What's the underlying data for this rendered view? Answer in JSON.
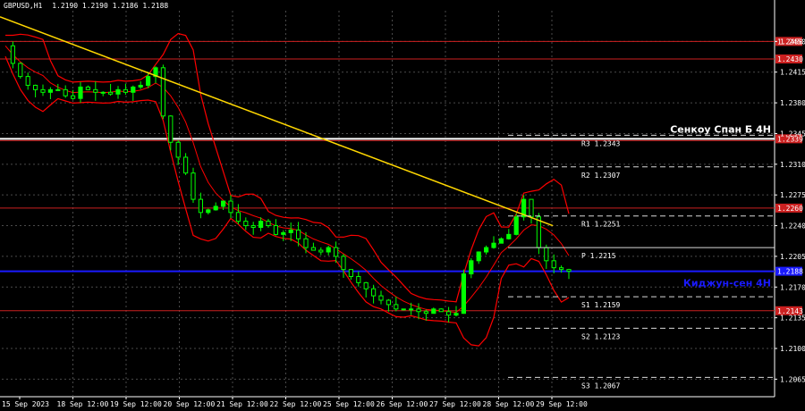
{
  "header": {
    "symbol": "GBPUSD,H1",
    "ohlc": "1.2190 1.2190 1.2186 1.2188"
  },
  "colors": {
    "background": "#000000",
    "grid": "#4a4a4a",
    "bull_candle": "#00ff00",
    "bear_candle": "#00ff00",
    "bollinger": "#ff0000",
    "trendline": "#ffd700",
    "kijun": "#1a1aff",
    "level_line": "#cc2020",
    "pivot": "#d9d9d9",
    "axis_text": "#ffffff"
  },
  "chart_data": {
    "type": "candlestick",
    "xlabel": "",
    "ylabel": "",
    "ylim": [
      1.2045,
      1.2485
    ],
    "x_ticks": [
      "15 Sep 2023",
      "18 Sep 12:00",
      "19 Sep 12:00",
      "20 Sep 12:00",
      "21 Sep 12:00",
      "22 Sep 12:00",
      "25 Sep 12:00",
      "26 Sep 12:00",
      "27 Sep 12:00",
      "28 Sep 12:00",
      "29 Sep 12:00"
    ],
    "y_ticks": [
      "1.2450",
      "1.2415",
      "1.2380",
      "1.2345",
      "1.2310",
      "1.2275",
      "1.2240",
      "1.2205",
      "1.2170",
      "1.2135",
      "1.2100",
      "1.2065"
    ],
    "close_path": [
      1.2445,
      1.2425,
      1.241,
      1.24,
      1.2395,
      1.2392,
      1.2395,
      1.2395,
      1.2388,
      1.2385,
      1.2398,
      1.2395,
      1.2392,
      1.2392,
      1.239,
      1.2395,
      1.2392,
      1.2398,
      1.24,
      1.241,
      1.242,
      1.2365,
      1.2335,
      1.2318,
      1.23,
      1.227,
      1.2255,
      1.2258,
      1.2262,
      1.2268,
      1.2255,
      1.2245,
      1.224,
      1.2238,
      1.2245,
      1.224,
      1.223,
      1.2232,
      1.2235,
      1.2225,
      1.2215,
      1.2212,
      1.221,
      1.2215,
      1.2205,
      1.219,
      1.2182,
      1.2175,
      1.2168,
      1.216,
      1.2155,
      1.215,
      1.2145,
      1.2145,
      1.2145,
      1.2142,
      1.214,
      1.2145,
      1.2142,
      1.2138,
      1.214,
      1.2185,
      1.22,
      1.221,
      1.2215,
      1.222,
      1.2225,
      1.223,
      1.225,
      1.227,
      1.225,
      1.2215,
      1.22,
      1.2192,
      1.219,
      1.2188
    ],
    "horizontal_levels": [
      {
        "price": 1.245,
        "label": "1.2450",
        "style": "level"
      },
      {
        "price": 1.243,
        "label": "1.2430",
        "style": "level"
      },
      {
        "price": 1.2339,
        "label": "1.2339",
        "style": "senkou"
      },
      {
        "price": 1.226,
        "label": "1.2260",
        "style": "level"
      },
      {
        "price": 1.2188,
        "label": "1.2188",
        "style": "kijun"
      },
      {
        "price": 1.2143,
        "label": "1.2143",
        "style": "level"
      }
    ],
    "pivots": [
      {
        "name": "R3",
        "value": "1.2343",
        "price": 1.2343
      },
      {
        "name": "R2",
        "value": "1.2307",
        "price": 1.2307
      },
      {
        "name": "R1",
        "value": "1.2251",
        "price": 1.2251
      },
      {
        "name": "P",
        "value": "1.2215",
        "price": 1.2215
      },
      {
        "name": "S1",
        "value": "1.2159",
        "price": 1.2159
      },
      {
        "name": "S2",
        "value": "1.2123",
        "price": 1.2123
      },
      {
        "name": "S3",
        "value": "1.2067",
        "price": 1.2067
      }
    ],
    "trendline": {
      "from": 1.2478,
      "to": 1.224
    },
    "annotations": [
      {
        "text": "Сенкоу Спан Б 4Н",
        "price": 1.235
      },
      {
        "text": "Киджун-сен 4Н",
        "price": 1.2175
      }
    ]
  }
}
